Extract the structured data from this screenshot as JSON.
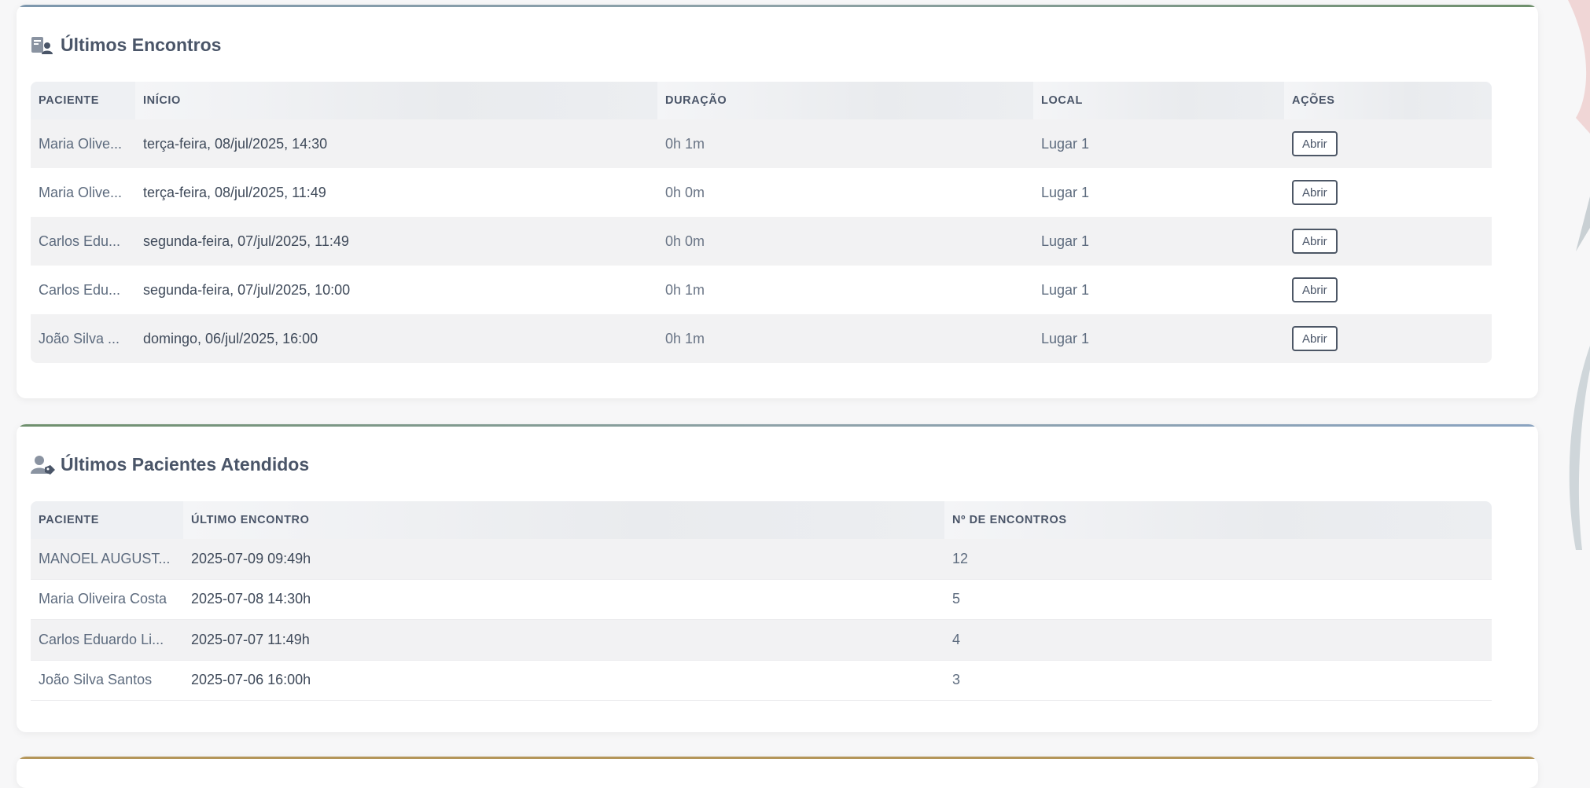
{
  "encounters": {
    "title": "Últimos Encontros",
    "columns": {
      "patient": "PACIENTE",
      "start": "INÍCIO",
      "duration": "DURAÇÃO",
      "location": "LOCAL",
      "actions": "AÇÕES"
    },
    "rows": [
      {
        "patient": "Maria Olive...",
        "start": "terça-feira, 08/jul/2025, 14:30",
        "duration": "0h 1m",
        "location": "Lugar 1",
        "action": "Abrir"
      },
      {
        "patient": "Maria Olive...",
        "start": "terça-feira, 08/jul/2025, 11:49",
        "duration": "0h 0m",
        "location": "Lugar 1",
        "action": "Abrir"
      },
      {
        "patient": "Carlos Edu...",
        "start": "segunda-feira, 07/jul/2025, 11:49",
        "duration": "0h 0m",
        "location": "Lugar 1",
        "action": "Abrir"
      },
      {
        "patient": "Carlos Edu...",
        "start": "segunda-feira, 07/jul/2025, 10:00",
        "duration": "0h 1m",
        "location": "Lugar 1",
        "action": "Abrir"
      },
      {
        "patient": "João Silva ...",
        "start": "domingo, 06/jul/2025, 16:00",
        "duration": "0h 1m",
        "location": "Lugar 1",
        "action": "Abrir"
      }
    ]
  },
  "patients": {
    "title": "Últimos Pacientes Atendidos",
    "columns": {
      "patient": "PACIENTE",
      "last": "ÚLTIMO ENCONTRO",
      "count": "Nº DE ENCONTROS"
    },
    "rows": [
      {
        "patient": "MANOEL AUGUST...",
        "last": "2025-07-09 09:49h",
        "count": "12"
      },
      {
        "patient": "Maria Oliveira Costa",
        "last": "2025-07-08 14:30h",
        "count": "5"
      },
      {
        "patient": "Carlos Eduardo Li...",
        "last": "2025-07-07 11:49h",
        "count": "4"
      },
      {
        "patient": "João Silva Santos",
        "last": "2025-07-06 16:00h",
        "count": "3"
      }
    ]
  },
  "colors": {
    "accent_blue": "#7d97ad",
    "accent_green": "#6e8f6c",
    "accent_gold": "#b4965a",
    "text": "#4a5568"
  }
}
